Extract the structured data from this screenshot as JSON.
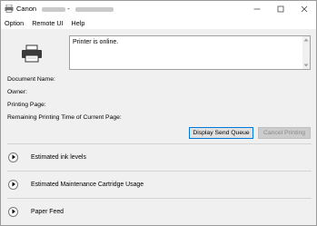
{
  "titlebar": {
    "app_name": "Canon",
    "separator": "-",
    "icons": [
      "printer-icon",
      "minimize-icon",
      "maximize-icon",
      "close-icon"
    ]
  },
  "menu": {
    "items": [
      "Option",
      "Remote UI",
      "Help"
    ]
  },
  "status": {
    "message": "Printer is online."
  },
  "info": {
    "document_name": "Document Name:",
    "owner": "Owner:",
    "printing_page": "Printing Page:",
    "remaining_time": "Remaining Printing Time of Current Page:"
  },
  "buttons": {
    "display_send_queue": "Display Send Queue",
    "cancel_printing": "Cancel Printing"
  },
  "sections": [
    {
      "label": "Estimated ink levels"
    },
    {
      "label": "Estimated Maintenance Cartridge Usage"
    },
    {
      "label": "Paper Feed"
    }
  ],
  "colors": {
    "focus_border": "#0078d7",
    "window_bg": "#f0f0f0",
    "disabled_text": "#8a8a8a"
  }
}
